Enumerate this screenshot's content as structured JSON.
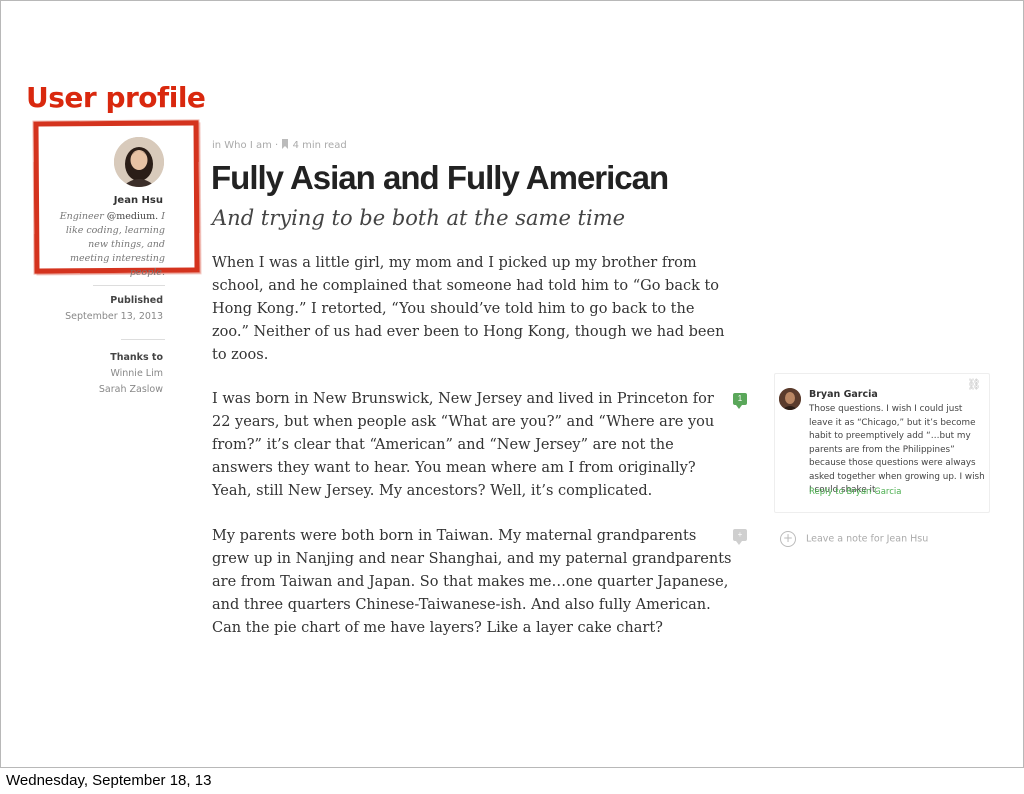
{
  "slide": {
    "title": "User profile",
    "footer_date": "Wednesday, September 18, 13"
  },
  "sidebar": {
    "author_name": "Jean Hsu",
    "bio_prefix": "Engineer",
    "bio_handle": "@medium.",
    "bio_rest": "I like coding, learning new things, and meeting interesting people.",
    "published_label": "Published",
    "published_date": "September 13, 2013",
    "thanks_label": "Thanks to",
    "thanks": [
      "Winnie Lim",
      "Sarah Zaslow"
    ]
  },
  "article": {
    "collection": "in Who I am",
    "separator": "·",
    "read_time": "4 min read",
    "title": "Fully Asian and Fully American",
    "subtitle": "And trying to be both at the same time",
    "paragraphs": [
      "When I was a little girl, my mom and I picked up my brother from school, and he complained that someone had told him to “Go back to Hong Kong.” I retorted, “You should’ve told him to go back to the zoo.” Neither of us had ever been to Hong Kong, though we had been to zoos.",
      "I was born in New Brunswick, New Jersey and lived in Princeton for 22 years, but when people ask “What are you?” and “Where are you from?” it’s clear that “American” and “New Jersey” are not the answers they want to hear. You mean where am I from originally? Yeah, still New Jersey. My ancestors? Well, it’s complicated.",
      "My parents were both born in Taiwan. My maternal grandparents grew up in Nanjing and near Shanghai, and my paternal grandparents are from Taiwan and Japan. So that makes me…one quarter Japanese, and three quarters Chinese-Taiwanese-ish. And also fully American. Can the pie chart of me have layers? Like a layer cake chart?"
    ],
    "note_count_para2": "1",
    "note_count_para3": "+"
  },
  "note": {
    "author": "Bryan Garcia",
    "text": "Those questions. I wish I could just leave it as “Chicago,” but it’s become habit to preemptively add “…but my parents are from the Philippines” because those questions were always asked together when growing up. I wish I could shake it.",
    "reply_label": "Reply to Bryan Garcia",
    "leave_note_label": "Leave a note for Jean Hsu"
  },
  "colors": {
    "accent": "#d9280e",
    "note_green": "#5aa75a",
    "note_gray": "#cfcfcf"
  }
}
